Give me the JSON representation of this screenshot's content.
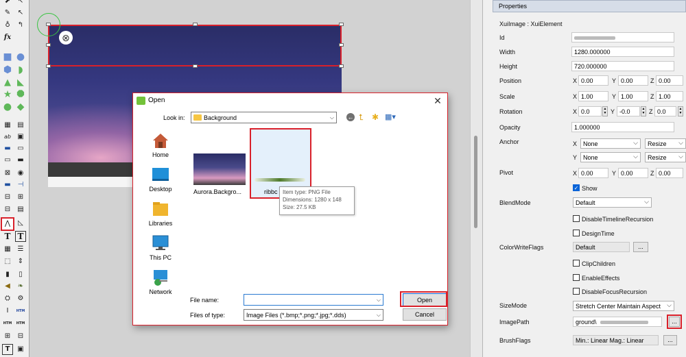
{
  "toolbox": {
    "icons": [
      "pointer-icon",
      "select-arrow-icon",
      "pen-icon",
      "subselect-icon",
      "fx-icon",
      "rectangle-icon",
      "ellipse-icon",
      "hexagon-icon",
      "half-circle-icon",
      "triangle-icon",
      "flag-icon",
      "star-icon",
      "octagon-icon",
      "circle-icon",
      "diamond-icon",
      "grid-control-icon",
      "list-control-icon",
      "text-ab-icon",
      "image-control-icon",
      "button-control-icon",
      "button-alt-icon",
      "edit-control-icon",
      "edit-alt-icon",
      "close-x-icon",
      "radio-icon",
      "progress-icon",
      "slider-icon",
      "tree-icon",
      "tree-alt-icon",
      "image-tool-icon",
      "image-alt-icon",
      "text-t-icon",
      "text-bold-t-icon",
      "film-icon",
      "list-icon",
      "dotted-box-icon",
      "scroll-arrows-icon",
      "battery-icon",
      "battery-alt-icon",
      "speaker-icon",
      "leaf-icon",
      "scene-icon",
      "gear-icon",
      "cursor-i-icon",
      "html-text-icon",
      "html-icon",
      "html-alt-icon",
      "group-icon",
      "group-alt-icon",
      "texture-icon",
      "texture-alt-icon"
    ],
    "fx_label": "fx",
    "html_label": "HTM",
    "text_t": "T"
  },
  "dialog": {
    "title": "Open",
    "close_glyph": "✕",
    "look_in_label": "Look in:",
    "look_in_value": "Background",
    "places": [
      {
        "label": "Home",
        "icon": "home-icon"
      },
      {
        "label": "Desktop",
        "icon": "desktop-icon"
      },
      {
        "label": "Libraries",
        "icon": "libraries-icon"
      },
      {
        "label": "This PC",
        "icon": "this-pc-icon"
      },
      {
        "label": "Network",
        "icon": "network-icon"
      }
    ],
    "files": [
      {
        "name": "Aurora.Backgro..."
      },
      {
        "name": "ribbc"
      }
    ],
    "tooltip": {
      "type": "Item type: PNG File",
      "dims": "Dimensions: 1280 x 148",
      "size": "Size: 27.5 KB"
    },
    "file_name_label": "File name:",
    "file_name_value": "",
    "files_of_type_label": "Files of type:",
    "files_of_type_value": "Image Files (*.bmp;*.png;*.jpg;*.dds)",
    "open_label": "Open",
    "cancel_label": "Cancel"
  },
  "properties": {
    "header": "Properties",
    "element_type": "XuiImage : XuiElement",
    "id_label": "Id",
    "width_label": "Width",
    "width_value": "1280.000000",
    "height_label": "Height",
    "height_value": "720.000000",
    "position_label": "Position",
    "position": {
      "x": "0.00",
      "y": "0.00",
      "z": "0.00"
    },
    "scale_label": "Scale",
    "scale": {
      "x": "1.00",
      "y": "1.00",
      "z": "1.00"
    },
    "rotation_label": "Rotation",
    "rotation": {
      "x": "0.0",
      "y": "-0.0",
      "z": "0.0"
    },
    "opacity_label": "Opacity",
    "opacity_value": "1.000000",
    "anchor_label": "Anchor",
    "anchor_x": "None",
    "anchor_x_resize": "Resize",
    "anchor_y": "None",
    "anchor_y_resize": "Resize",
    "pivot_label": "Pivot",
    "pivot": {
      "x": "0.00",
      "y": "0.00",
      "z": "0.00"
    },
    "x": "X",
    "y": "Y",
    "z": "Z",
    "show_label": "Show",
    "blendmode_label": "BlendMode",
    "blendmode_value": "Default",
    "disable_timeline_label": "DisableTimelineRecursion",
    "designtime_label": "DesignTime",
    "colorwrite_label": "ColorWriteFlags",
    "colorwrite_value": "Default",
    "ellipsis": "...",
    "clipchildren_label": "ClipChildren",
    "enableeffects_label": "EnableEffects",
    "disablefocus_label": "DisableFocusRecursion",
    "sizemode_label": "SizeMode",
    "sizemode_value": "Stretch Center Maintain Aspect",
    "imagepath_label": "ImagePath",
    "imagepath_value": "ground\\",
    "brushflags_label": "BrushFlags",
    "brushflags_value": "Min.: Linear Mag.: Linear"
  }
}
